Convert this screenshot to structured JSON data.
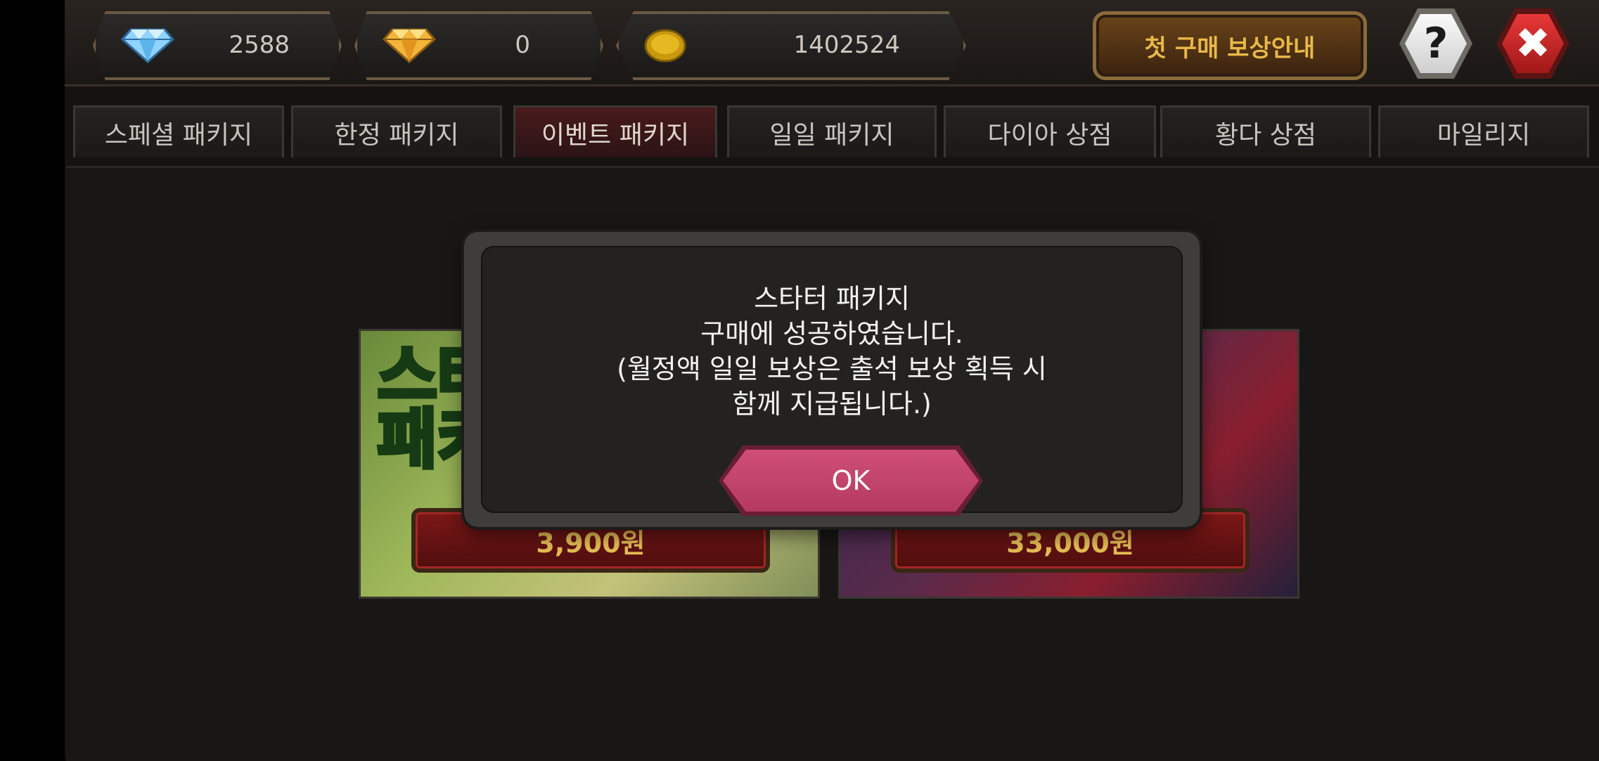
{
  "currency": {
    "diamond": "2588",
    "gold_diamond": "0",
    "coin": "1402524"
  },
  "header": {
    "first_purchase_label": "첫 구매 보상안내",
    "help_label": "?",
    "close_label": "✖"
  },
  "tabs": [
    {
      "label": "스페셜 패키지",
      "active": false
    },
    {
      "label": "한정 패키지",
      "active": false
    },
    {
      "label": "이벤트 패키지",
      "active": true
    },
    {
      "label": "일일 패키지",
      "active": false
    },
    {
      "label": "다이아 상점",
      "active": false
    },
    {
      "label": "황다 상점",
      "active": false
    },
    {
      "label": "마일리지",
      "active": false
    }
  ],
  "packages": [
    {
      "art_text": "스타\n패키",
      "price": "3,900원"
    },
    {
      "art_text": "",
      "price": "33,000원"
    }
  ],
  "dialog": {
    "line1": "스타터 패키지",
    "line2": "구매에 성공하였습니다.",
    "line3": "(월정액 일일 보상은 출석 보상 획득 시",
    "line4": "함께 지급됩니다.)",
    "ok_label": "OK"
  },
  "colors": {
    "accent_gold": "#e8bf55",
    "ok_button": "#c04468",
    "active_tab": "#4a1a1c"
  }
}
